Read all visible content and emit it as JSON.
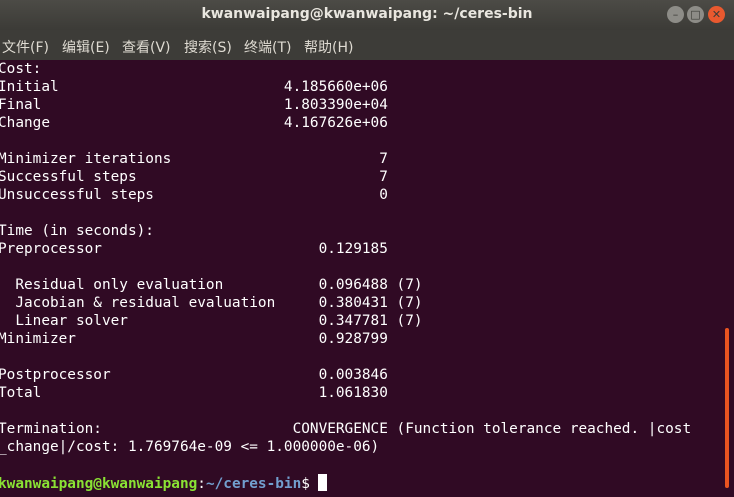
{
  "window": {
    "title": "kwanwaipang@kwanwaipang: ~/ceres-bin",
    "minimize_glyph": "–",
    "maximize_glyph": "□",
    "close_glyph": "✕"
  },
  "menu": [
    {
      "label": "文件(F)"
    },
    {
      "label": "编辑(E)"
    },
    {
      "label": "查看(V)"
    },
    {
      "label": "搜索(S)"
    },
    {
      "label": "终端(T)"
    },
    {
      "label": "帮助(H)"
    }
  ],
  "terminal": {
    "lines": [
      "Cost:",
      "Initial                          4.185660e+06",
      "Final                            1.803390e+04",
      "Change                           4.167626e+06",
      "",
      "Minimizer iterations                        7",
      "Successful steps                            7",
      "Unsuccessful steps                          0",
      "",
      "Time (in seconds):",
      "Preprocessor                         0.129185",
      "",
      "  Residual only evaluation           0.096488 (7)",
      "  Jacobian & residual evaluation     0.380431 (7)",
      "  Linear solver                      0.347781 (7)",
      "Minimizer                            0.928799",
      "",
      "Postprocessor                        0.003846",
      "Total                                1.061830",
      "",
      "Termination:                      CONVERGENCE (Function tolerance reached. |cost",
      "_change|/cost: 1.769764e-09 <= 1.000000e-06)",
      ""
    ],
    "prompt": {
      "user_host": "kwanwaipang@kwanwaipang",
      "separator": ":",
      "path": "~/ceres-bin",
      "symbol": "$"
    }
  },
  "colors": {
    "terminal_bg": "#300a24",
    "prompt_user": "#8ae234",
    "prompt_path": "#729fcf",
    "scrollbar": "#e95420"
  }
}
